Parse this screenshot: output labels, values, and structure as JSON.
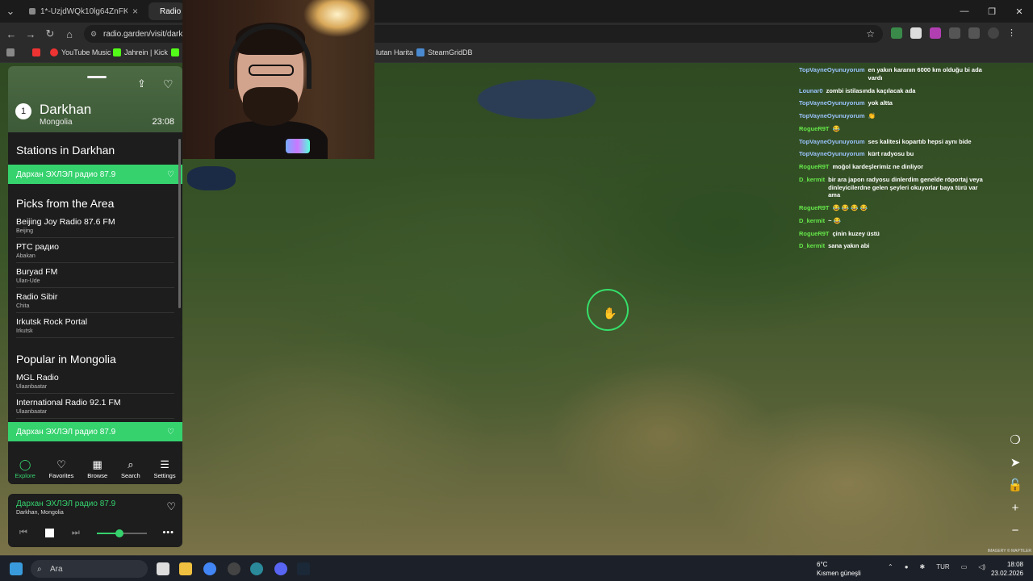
{
  "browser": {
    "tabs": [
      {
        "title": "1*-UzjdWQk10lg64ZnFKhj3g.p",
        "active": false
      },
      {
        "title": "Radio",
        "active": true
      }
    ],
    "url": "radio.garden/visit/darkh",
    "bookmarks": [
      "YouTube Music",
      "Jahrein | Kick",
      "lutan Harita",
      "SteamGridDB"
    ]
  },
  "sidebar": {
    "rank": "1",
    "city": "Darkhan",
    "country": "Mongolia",
    "local_time": "23:08",
    "stations_heading": "Stations in Darkhan",
    "highlighted_station": "Дархан ЭХЛЭЛ радио 87.9",
    "picks_heading": "Picks from the Area",
    "picks": [
      {
        "name": "Beijing Joy Radio 87.6 FM",
        "city": "Beijing"
      },
      {
        "name": "РТС радио",
        "city": "Abakan"
      },
      {
        "name": "Buryad FM",
        "city": "Ulan-Ude"
      },
      {
        "name": "Radio Sibir",
        "city": "Chita"
      },
      {
        "name": "Irkutsk Rock Portal",
        "city": "Irkutsk"
      }
    ],
    "popular_heading": "Popular in Mongolia",
    "popular": [
      {
        "name": "MGL Radio",
        "city": "Ulaanbaatar"
      },
      {
        "name": "International Radio 92.1 FM",
        "city": "Ulaanbaatar"
      }
    ],
    "popular_highlight": "Дархан ЭХЛЭЛ радио 87.9"
  },
  "nav": [
    {
      "label": "Explore",
      "icon": "explore-icon",
      "active": true
    },
    {
      "label": "Favorites",
      "icon": "heart-icon",
      "active": false
    },
    {
      "label": "Browse",
      "icon": "map-icon",
      "active": false
    },
    {
      "label": "Search",
      "icon": "search-icon",
      "active": false
    },
    {
      "label": "Settings",
      "icon": "menu-icon",
      "active": false
    }
  ],
  "player": {
    "station": "Дархан ЭХЛЭЛ радио 87.9",
    "location": "Darkhan, Mongolia",
    "volume": 0.45
  },
  "chat": [
    {
      "user": "TopVayneOyunuyorum",
      "color": "blue",
      "message": "en yakın karanın 6000 km olduğu bi ada vardı"
    },
    {
      "user": "Lounar0",
      "color": "blue",
      "message": "zombi istilasında kaçılacak ada"
    },
    {
      "user": "TopVayneOyunuyorum",
      "color": "blue",
      "message": "yok altta"
    },
    {
      "user": "TopVayneOyunuyorum",
      "color": "blue",
      "message": "👏"
    },
    {
      "user": "RogueR9T",
      "color": "green",
      "message": "😂"
    },
    {
      "user": "TopVayneOyunuyorum",
      "color": "blue",
      "message": "ses kalitesi kopartıb hepsi aynı bide"
    },
    {
      "user": "TopVayneOyunuyorum",
      "color": "blue",
      "message": "kürt radyosu bu"
    },
    {
      "user": "RogueR9T",
      "color": "green",
      "message": "moğol kardeşlerimiz ne dinliyor"
    },
    {
      "user": "D_kermit",
      "color": "green",
      "message": "bir ara japon radyosu dinlerdim genelde röportaj veya dinleyicilerdne gelen şeyleri okuyorlar baya türü var ama"
    },
    {
      "user": "RogueR9T",
      "color": "green",
      "message": "😂 😂 😂 😂"
    },
    {
      "user": "D_kermit",
      "color": "green",
      "message": "~ 😂"
    },
    {
      "user": "RogueR9T",
      "color": "green",
      "message": "çinin kuzey üstü"
    },
    {
      "user": "D_kermit",
      "color": "green",
      "message": "sana yakın abi"
    }
  ],
  "map": {
    "attribution": "IMAGERY © MAPTILER"
  },
  "taskbar": {
    "search_placeholder": "Ara",
    "weather_temp": "6°C",
    "weather_desc": "Kısmen güneşli",
    "lang": "TUR",
    "time": "18:08",
    "date": "23.02.2026"
  }
}
